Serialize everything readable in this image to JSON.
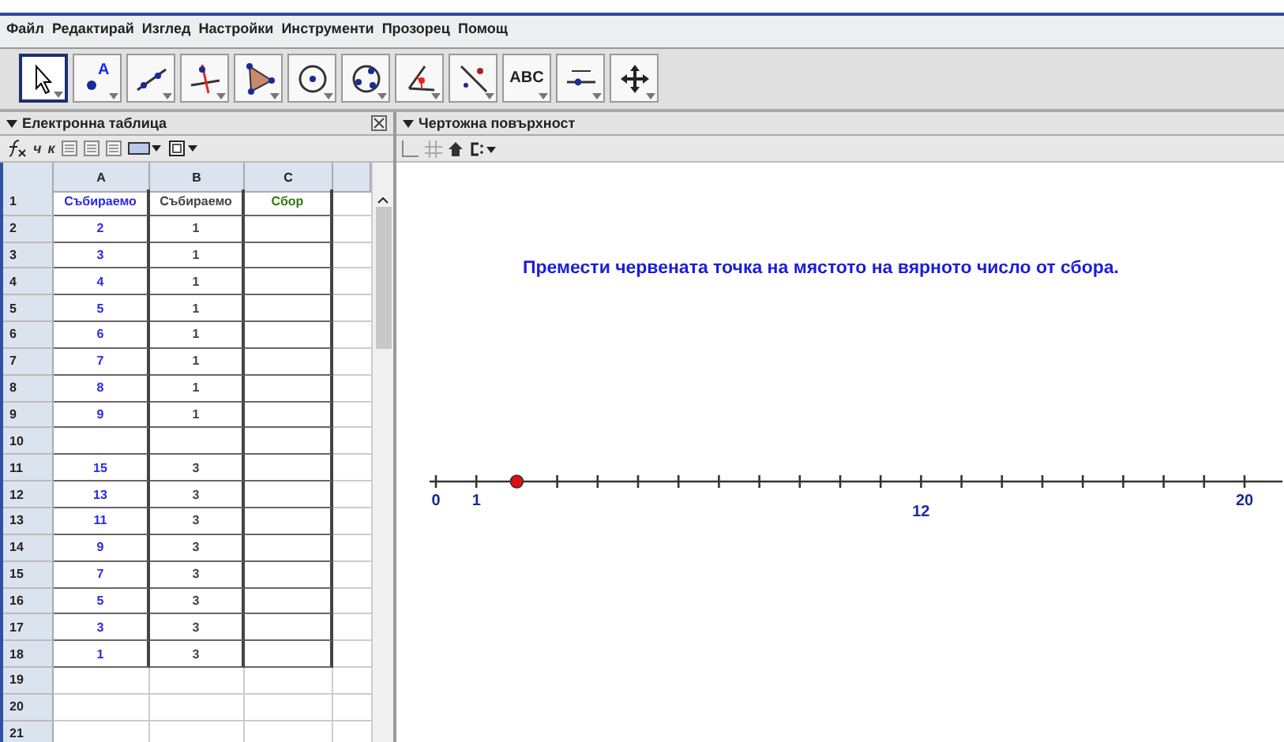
{
  "menu": [
    "Файл",
    "Редактирай",
    "Изглед",
    "Настройки",
    "Инструменти",
    "Прозорец",
    "Помощ"
  ],
  "tools": [
    {
      "kind": "pointer",
      "selected": true
    },
    {
      "kind": "point",
      "selected": false,
      "label": "A"
    },
    {
      "kind": "line",
      "selected": false
    },
    {
      "kind": "perpendicular",
      "selected": false
    },
    {
      "kind": "polygon",
      "selected": false
    },
    {
      "kind": "circle",
      "selected": false
    },
    {
      "kind": "circle3",
      "selected": false
    },
    {
      "kind": "angle",
      "selected": false
    },
    {
      "kind": "reflect",
      "selected": false
    },
    {
      "kind": "text",
      "selected": false,
      "label": "ABC"
    },
    {
      "kind": "slider",
      "selected": false
    },
    {
      "kind": "move",
      "selected": false
    }
  ],
  "spreadsheet": {
    "title": "Електронна таблица",
    "style_bar": [
      "ч",
      "к"
    ],
    "columns": [
      "A",
      "B",
      "C"
    ],
    "rows": [
      {
        "label": "1",
        "framed": true,
        "cells": [
          {
            "text": "Събираемо",
            "color": "#2a2ae8"
          },
          {
            "text": "Събираемо",
            "color": "#444444"
          },
          {
            "text": "Сбор",
            "color": "#2e7d0e"
          }
        ]
      },
      {
        "label": "2",
        "framed": true,
        "cells": [
          {
            "text": "2",
            "color": "#2a2ae8"
          },
          {
            "text": "1",
            "color": "#444444"
          }
        ]
      },
      {
        "label": "3",
        "framed": true,
        "cells": [
          {
            "text": "3",
            "color": "#2a2ae8"
          },
          {
            "text": "1",
            "color": "#444444"
          }
        ]
      },
      {
        "label": "4",
        "framed": true,
        "cells": [
          {
            "text": "4",
            "color": "#2a2ae8"
          },
          {
            "text": "1",
            "color": "#444444"
          }
        ]
      },
      {
        "label": "5",
        "framed": true,
        "cells": [
          {
            "text": "5",
            "color": "#2a2ae8"
          },
          {
            "text": "1",
            "color": "#444444"
          }
        ]
      },
      {
        "label": "6",
        "framed": true,
        "cells": [
          {
            "text": "6",
            "color": "#2a2ae8"
          },
          {
            "text": "1",
            "color": "#444444"
          }
        ]
      },
      {
        "label": "7",
        "framed": true,
        "cells": [
          {
            "text": "7",
            "color": "#2a2ae8"
          },
          {
            "text": "1",
            "color": "#444444"
          }
        ]
      },
      {
        "label": "8",
        "framed": true,
        "cells": [
          {
            "text": "8",
            "color": "#2a2ae8"
          },
          {
            "text": "1",
            "color": "#444444"
          }
        ]
      },
      {
        "label": "9",
        "framed": true,
        "cells": [
          {
            "text": "9",
            "color": "#2a2ae8"
          },
          {
            "text": "1",
            "color": "#444444"
          }
        ]
      },
      {
        "label": "10",
        "framed": true,
        "cells": []
      },
      {
        "label": "11",
        "framed": true,
        "cells": [
          {
            "text": "15",
            "color": "#2a2ae8"
          },
          {
            "text": "3",
            "color": "#444444"
          }
        ]
      },
      {
        "label": "12",
        "framed": true,
        "cells": [
          {
            "text": "13",
            "color": "#2a2ae8"
          },
          {
            "text": "3",
            "color": "#444444"
          }
        ]
      },
      {
        "label": "13",
        "framed": true,
        "cells": [
          {
            "text": "11",
            "color": "#2a2ae8"
          },
          {
            "text": "3",
            "color": "#444444"
          }
        ]
      },
      {
        "label": "14",
        "framed": true,
        "cells": [
          {
            "text": "9",
            "color": "#2a2ae8"
          },
          {
            "text": "3",
            "color": "#444444"
          }
        ]
      },
      {
        "label": "15",
        "framed": true,
        "cells": [
          {
            "text": "7",
            "color": "#2a2ae8"
          },
          {
            "text": "3",
            "color": "#444444"
          }
        ]
      },
      {
        "label": "16",
        "framed": true,
        "cells": [
          {
            "text": "5",
            "color": "#2a2ae8"
          },
          {
            "text": "3",
            "color": "#444444"
          }
        ]
      },
      {
        "label": "17",
        "framed": true,
        "cells": [
          {
            "text": "3",
            "color": "#2a2ae8"
          },
          {
            "text": "3",
            "color": "#444444"
          }
        ]
      },
      {
        "label": "18",
        "framed": true,
        "cells": [
          {
            "text": "1",
            "color": "#2a2ae8"
          },
          {
            "text": "3",
            "color": "#444444"
          }
        ]
      },
      {
        "label": "19",
        "framed": false,
        "cells": []
      },
      {
        "label": "20",
        "framed": false,
        "cells": []
      },
      {
        "label": "21",
        "framed": false,
        "cells": []
      }
    ]
  },
  "graphics": {
    "title": "Чертожна повърхност",
    "instruction": "Премести червената точка на мястото на вярното число от сбора.",
    "number_line": {
      "point": {
        "level": 0.1
      },
      "labels": [
        {
          "text": "0",
          "kind": "plain"
        },
        {
          "text": "1",
          "kind": "plain"
        },
        {
          "text": "12",
          "kind": "low"
        },
        {
          "text": "20",
          "kind": "plain"
        }
      ]
    }
  }
}
